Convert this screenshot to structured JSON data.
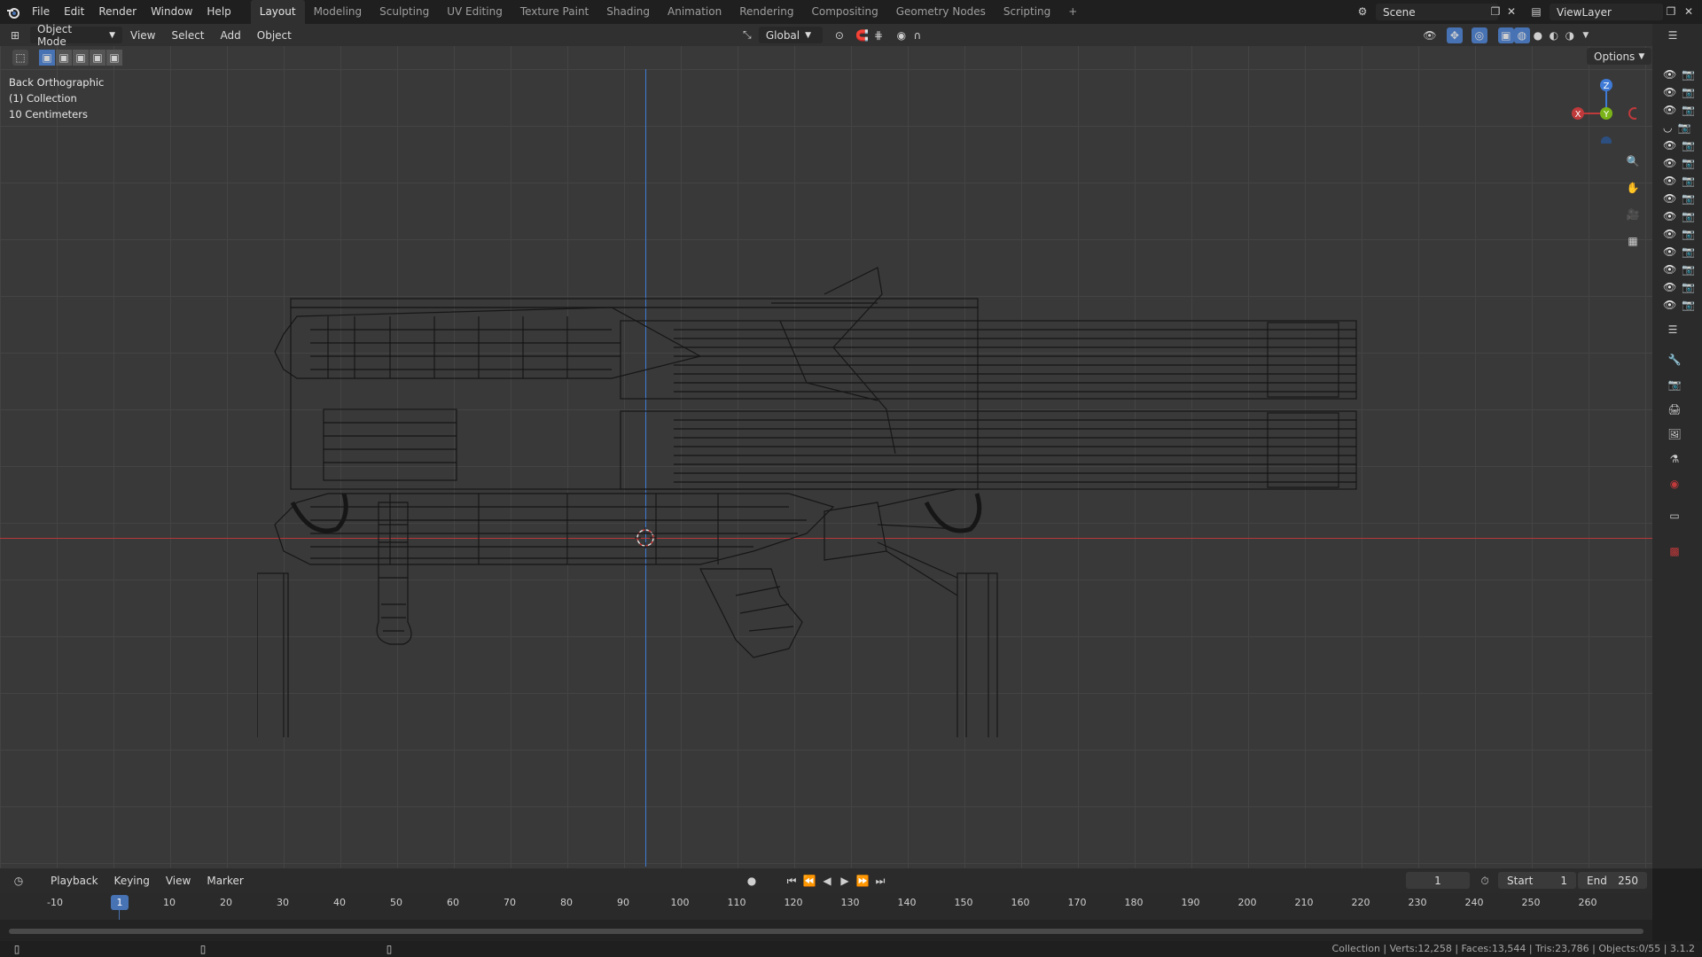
{
  "menu": [
    "File",
    "Edit",
    "Render",
    "Window",
    "Help"
  ],
  "workspaces": [
    "Layout",
    "Modeling",
    "Sculpting",
    "UV Editing",
    "Texture Paint",
    "Shading",
    "Animation",
    "Rendering",
    "Compositing",
    "Geometry Nodes",
    "Scripting"
  ],
  "active_workspace": "Layout",
  "add_workspace": "+",
  "scene": "Scene",
  "view_layer": "ViewLayer",
  "header": {
    "mode": "Object Mode",
    "menus": [
      "View",
      "Select",
      "Add",
      "Object"
    ],
    "orientation": "Global",
    "options": "Options"
  },
  "viewport": {
    "view_name": "Back Orthographic",
    "collection": "(1) Collection",
    "scale": "10 Centimeters",
    "gizmo": {
      "z": "Z",
      "y": "Y",
      "x": "X"
    }
  },
  "timeline": {
    "menus": [
      "Playback",
      "Keying",
      "View",
      "Marker"
    ],
    "current_frame": "1",
    "start_label": "Start",
    "start": "1",
    "end_label": "End",
    "end": "250",
    "ticks": [
      "-10",
      "1",
      "10",
      "20",
      "30",
      "40",
      "50",
      "60",
      "70",
      "80",
      "90",
      "100",
      "110",
      "120",
      "130",
      "140",
      "150",
      "160",
      "170",
      "180",
      "190",
      "200",
      "210",
      "220",
      "230",
      "240",
      "250",
      "260"
    ]
  },
  "status": "Collection | Verts:12,258 | Faces:13,544 | Tris:23,786 | Objects:0/55 | 3.1.2",
  "colors": {
    "x_axis": "#c0393b",
    "y_axis": "#7ab317",
    "z_axis": "#3e7ad6",
    "accent": "#4772b3"
  }
}
